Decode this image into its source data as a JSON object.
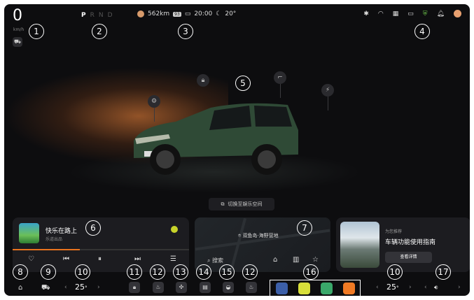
{
  "status": {
    "speed": "0",
    "speed_unit": "km/h",
    "gears": [
      "P",
      "R",
      "N",
      "D"
    ],
    "active_gear": "P",
    "range": "562km",
    "time": "20:00",
    "temperature": "20°"
  },
  "callouts": [
    "1",
    "2",
    "3",
    "4",
    "5",
    "6",
    "7",
    "8",
    "9",
    "10",
    "11",
    "12",
    "13",
    "14",
    "15",
    "12",
    "16",
    "10",
    "17"
  ],
  "switch_label": "切换至娱乐空间",
  "music": {
    "title": "快乐在路上",
    "artist": "乐道出品",
    "progress": 0.38
  },
  "map": {
    "destination": "双鱼岛·海野营地",
    "search": "搜索"
  },
  "promo": {
    "eyebrow": "为您推荐",
    "title": "车辆功能使用指南",
    "button": "查看详情"
  },
  "climate": {
    "left_temp": "25",
    "right_temp": "25",
    "unit": "°"
  },
  "colors": {
    "accent": "#e8731e",
    "background": "#0d0d0f",
    "car": "#2f4a36"
  }
}
